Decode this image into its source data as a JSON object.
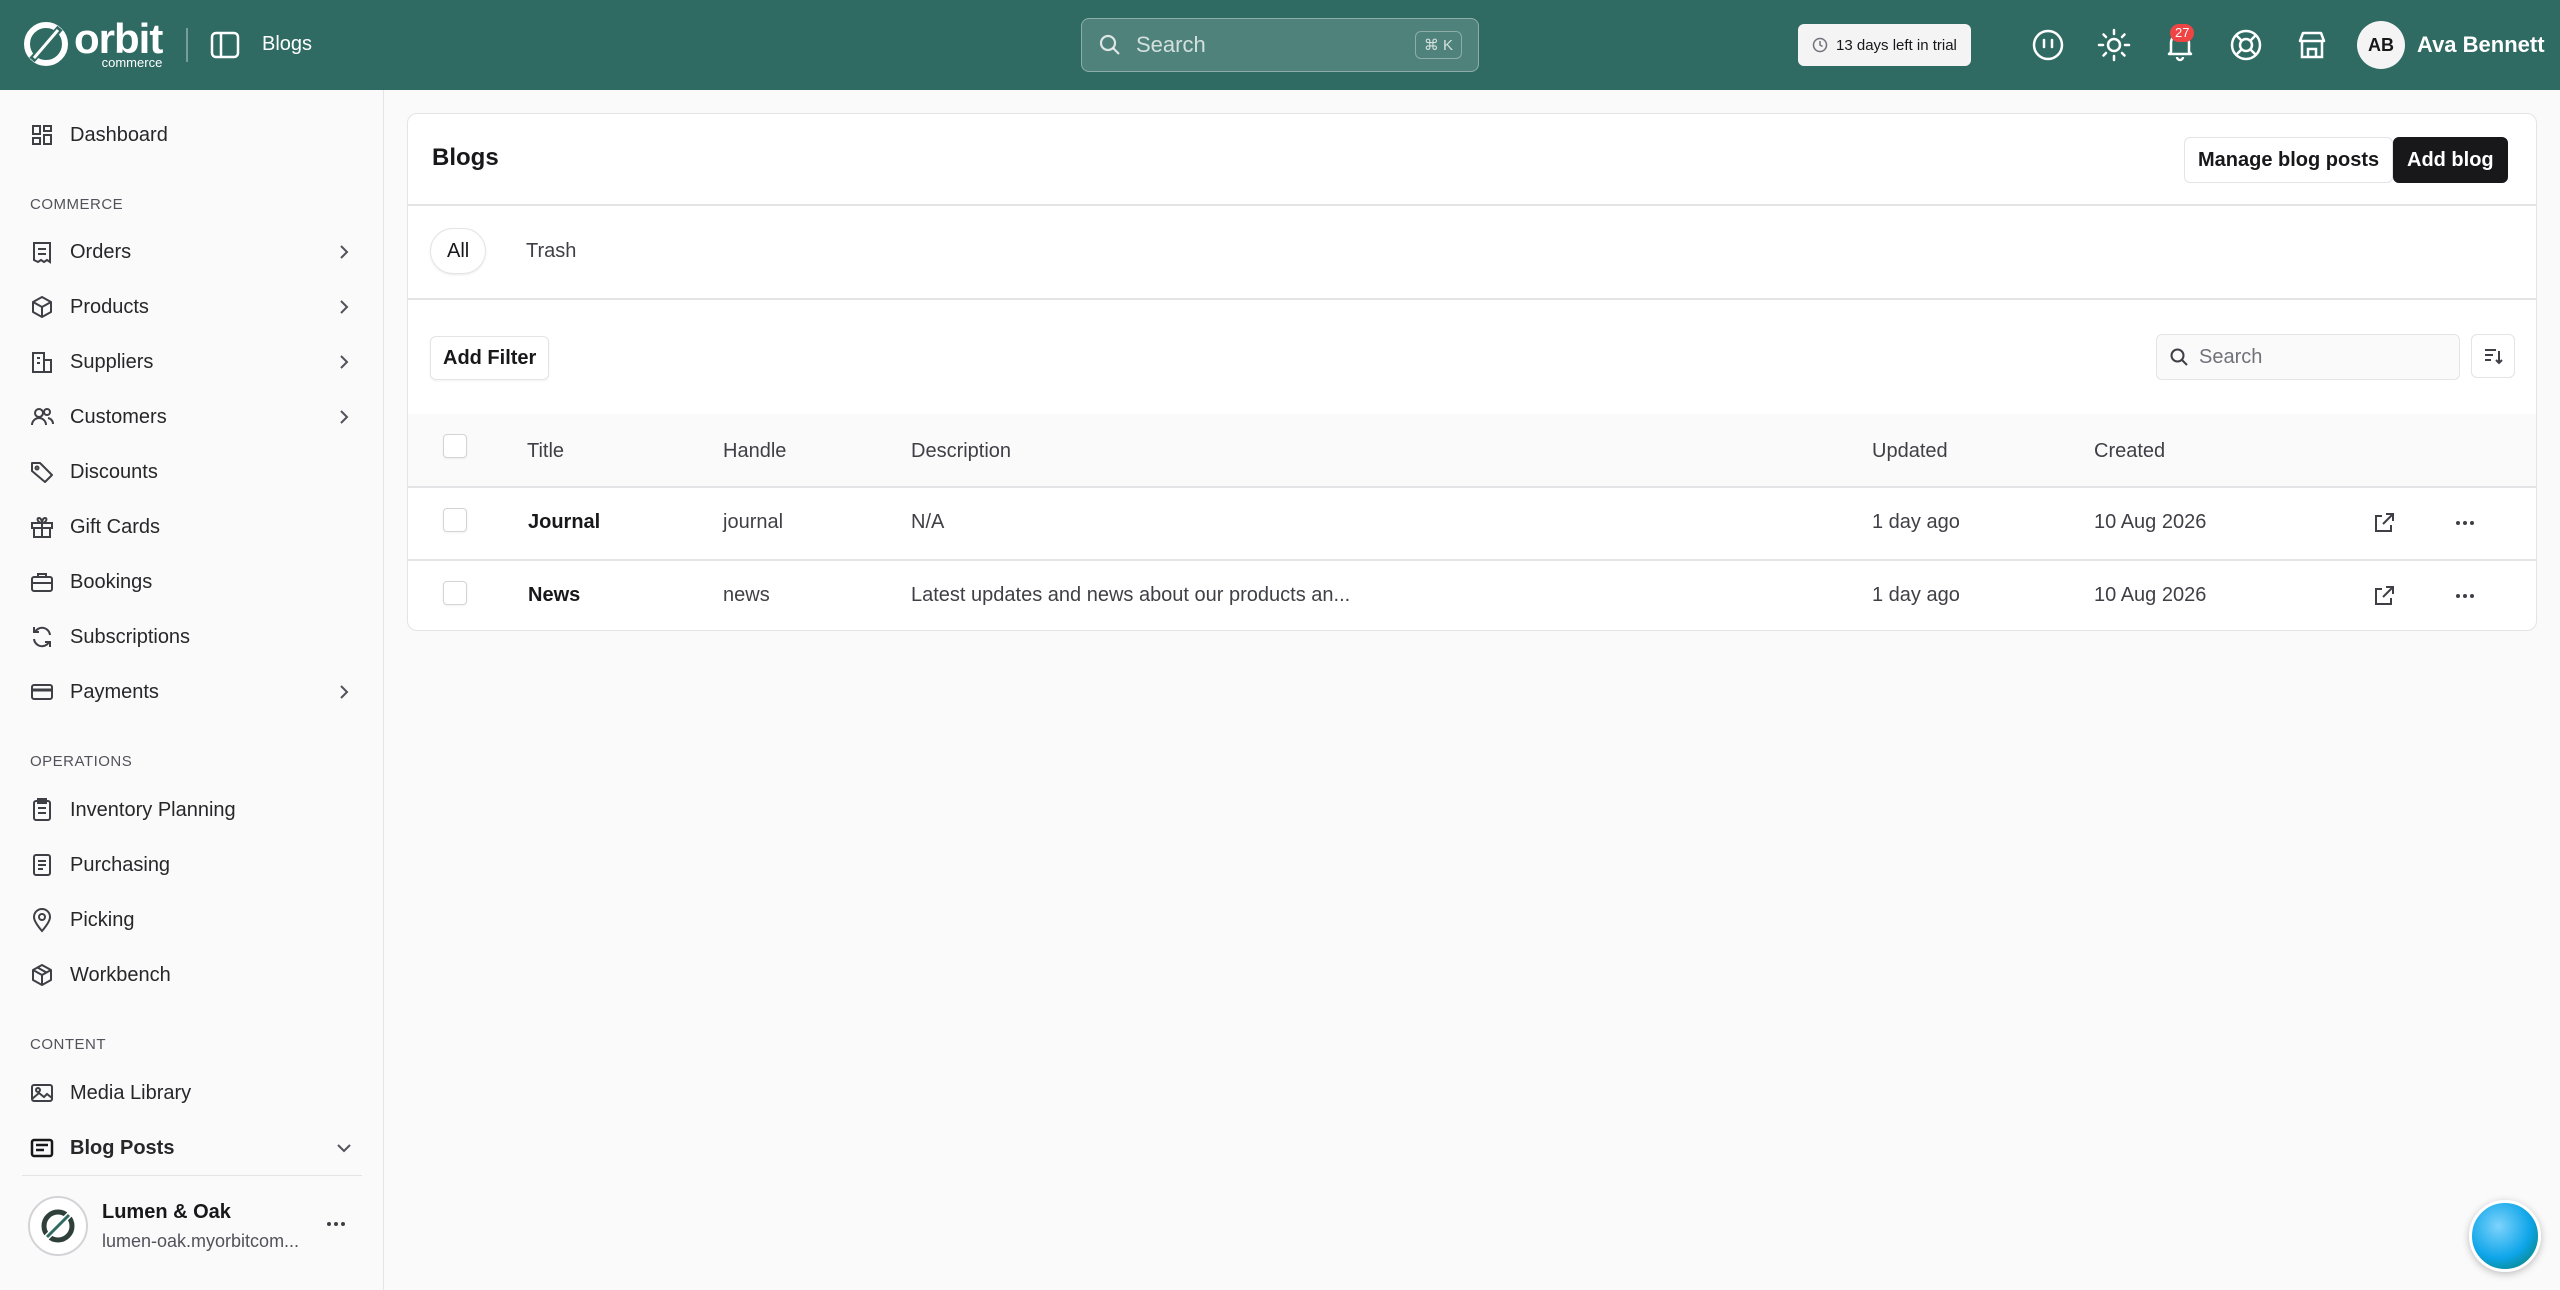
{
  "topbar": {
    "brand": "orbit",
    "brand_sub": "commerce",
    "page_title": "Blogs",
    "search_placeholder": "Search",
    "search_shortcut": "⌘ K",
    "trial_text": "13 days left in trial",
    "notification_count": "27",
    "user_initials": "AB",
    "user_name": "Ava Bennett",
    "color": "#2f6b63"
  },
  "sidebar": {
    "top": [
      {
        "label": "Dashboard",
        "icon": "dashboard-icon"
      }
    ],
    "sections": [
      {
        "label": "COMMERCE",
        "items": [
          {
            "label": "Orders",
            "icon": "orders-icon",
            "chevron": true
          },
          {
            "label": "Products",
            "icon": "products-icon",
            "chevron": true
          },
          {
            "label": "Suppliers",
            "icon": "suppliers-icon",
            "chevron": true
          },
          {
            "label": "Customers",
            "icon": "customers-icon",
            "chevron": true
          },
          {
            "label": "Discounts",
            "icon": "discounts-icon"
          },
          {
            "label": "Gift Cards",
            "icon": "gift-cards-icon"
          },
          {
            "label": "Bookings",
            "icon": "bookings-icon"
          },
          {
            "label": "Subscriptions",
            "icon": "subscriptions-icon"
          },
          {
            "label": "Payments",
            "icon": "payments-icon",
            "chevron": true
          }
        ]
      },
      {
        "label": "OPERATIONS",
        "items": [
          {
            "label": "Inventory Planning",
            "icon": "inventory-planning-icon"
          },
          {
            "label": "Purchasing",
            "icon": "purchasing-icon"
          },
          {
            "label": "Picking",
            "icon": "picking-icon"
          },
          {
            "label": "Workbench",
            "icon": "workbench-icon"
          }
        ]
      },
      {
        "label": "CONTENT",
        "items": [
          {
            "label": "Media Library",
            "icon": "media-library-icon"
          },
          {
            "label": "Blog Posts",
            "icon": "blog-posts-icon",
            "expanded": true
          }
        ]
      }
    ],
    "store": {
      "name": "Lumen & Oak",
      "url": "lumen-oak.myorbitcom..."
    }
  },
  "main": {
    "title": "Blogs",
    "manage_button": "Manage blog posts",
    "add_button": "Add blog",
    "tabs": [
      {
        "label": "All",
        "active": true
      },
      {
        "label": "Trash",
        "active": false
      }
    ],
    "add_filter": "Add Filter",
    "search_placeholder": "Search",
    "columns": [
      "Title",
      "Handle",
      "Description",
      "Updated",
      "Created"
    ],
    "rows": [
      {
        "title": "Journal",
        "handle": "journal",
        "description": "N/A",
        "updated": "1 day ago",
        "created": "10 Aug 2026"
      },
      {
        "title": "News",
        "handle": "news",
        "description": "Latest updates and news about our products an...",
        "updated": "1 day ago",
        "created": "10 Aug 2026"
      }
    ]
  }
}
